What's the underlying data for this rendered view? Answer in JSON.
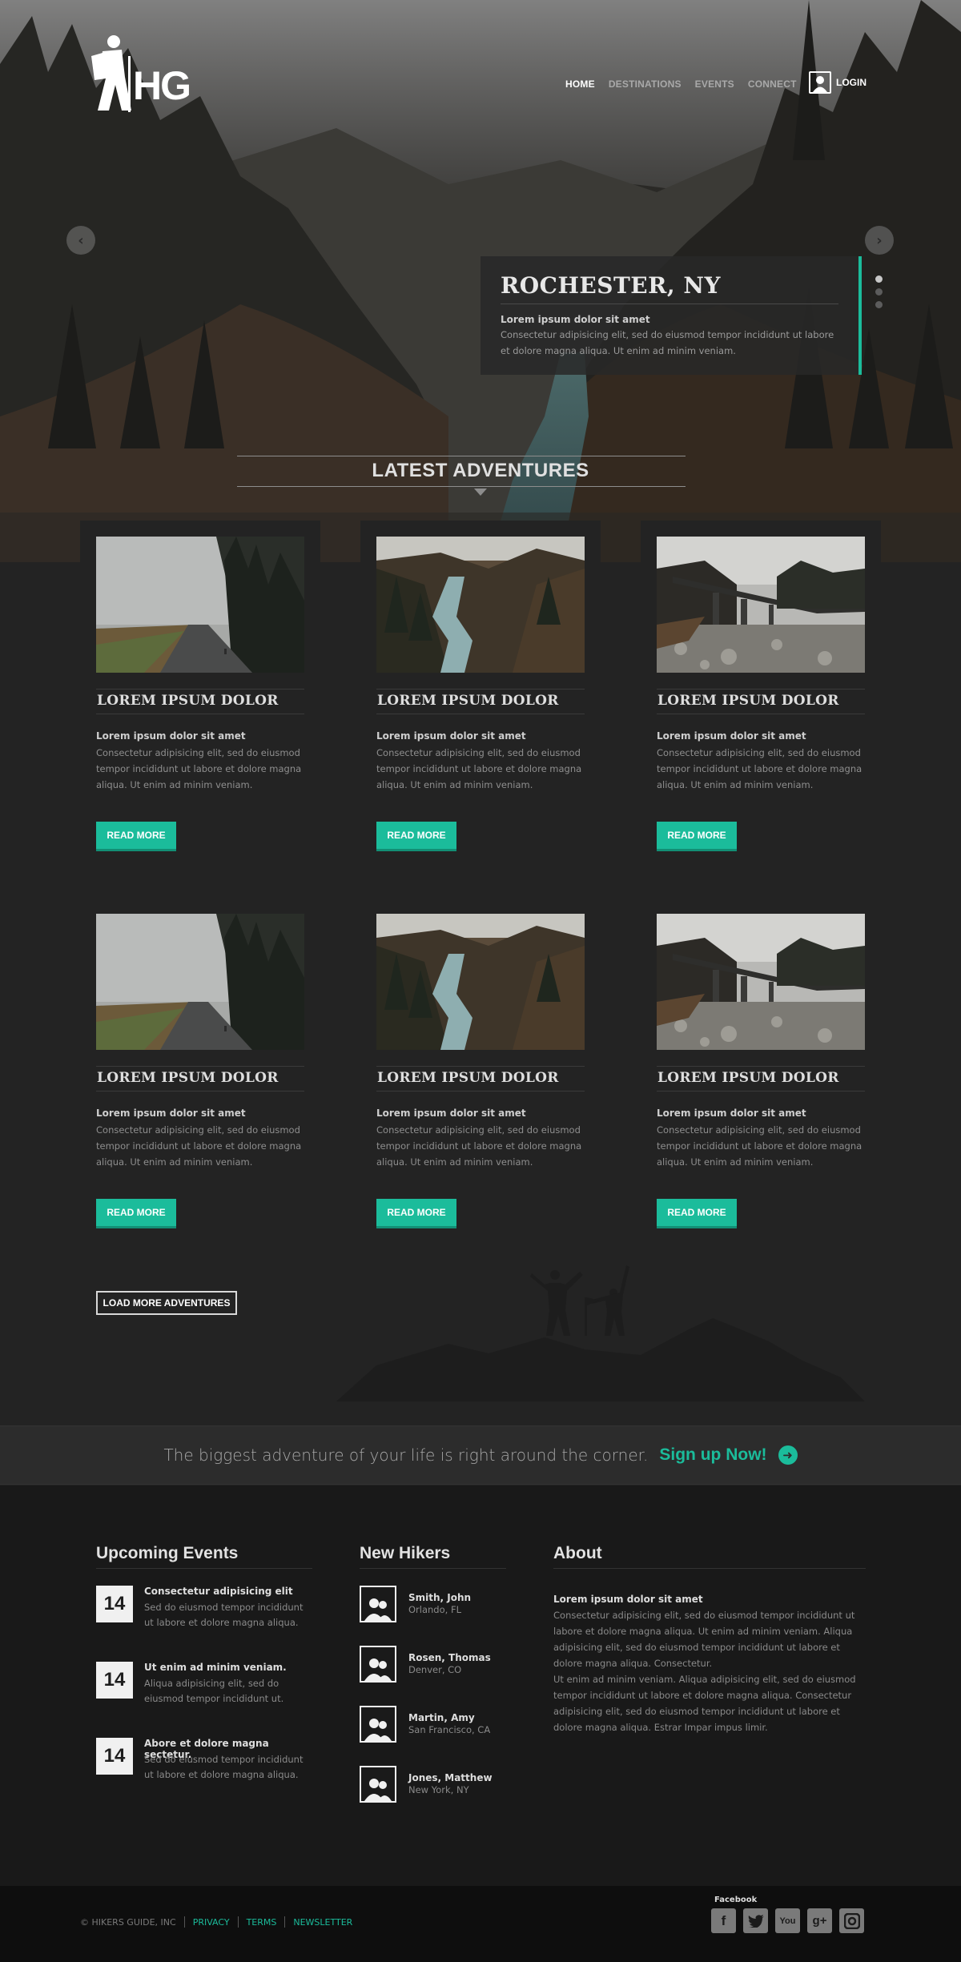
{
  "brand": {
    "logo_text": "HG"
  },
  "nav": {
    "items": [
      "HOME",
      "DESTINATIONS",
      "EVENTS",
      "CONNECT"
    ],
    "active": "HOME",
    "login": "LOGIN"
  },
  "hero": {
    "title": "ROCHESTER, NY",
    "subtitle": "Lorem ipsum dolor sit amet",
    "text": "Consectetur adipisicing elit, sed do eiusmod tempor incididunt ut labore et dolore magna aliqua. Ut enim ad minim veniam.",
    "slide_count": 3,
    "active_slide": 1
  },
  "section_title": "LATEST ADVENTURES",
  "cards": [
    {
      "title": "LOREM IPSUM DOLOR",
      "subtitle": "Lorem ipsum dolor sit amet",
      "text": "Consectetur adipisicing elit, sed do eiusmod tempor incididunt ut labore et dolore magna aliqua. Ut enim ad minim veniam.",
      "button": "READ MORE"
    },
    {
      "title": "LOREM IPSUM DOLOR",
      "subtitle": "Lorem ipsum dolor sit amet",
      "text": "Consectetur adipisicing elit, sed do eiusmod tempor incididunt ut labore et dolore magna aliqua. Ut enim ad minim veniam.",
      "button": "READ MORE"
    },
    {
      "title": "LOREM IPSUM DOLOR",
      "subtitle": "Lorem ipsum dolor sit amet",
      "text": "Consectetur adipisicing elit, sed do eiusmod tempor incididunt ut labore et dolore magna aliqua. Ut enim ad minim veniam.",
      "button": "READ MORE"
    },
    {
      "title": "LOREM IPSUM DOLOR",
      "subtitle": "Lorem ipsum dolor sit amet",
      "text": "Consectetur adipisicing elit, sed do eiusmod tempor incididunt ut labore et dolore magna aliqua. Ut enim ad minim veniam.",
      "button": "READ MORE"
    },
    {
      "title": "LOREM IPSUM DOLOR",
      "subtitle": "Lorem ipsum dolor sit amet",
      "text": "Consectetur adipisicing elit, sed do eiusmod tempor incididunt ut labore et dolore magna aliqua. Ut enim ad minim veniam.",
      "button": "READ MORE"
    },
    {
      "title": "LOREM IPSUM DOLOR",
      "subtitle": "Lorem ipsum dolor sit amet",
      "text": "Consectetur adipisicing elit, sed do eiusmod tempor incididunt ut labore et dolore magna aliqua. Ut enim ad minim veniam.",
      "button": "READ MORE"
    }
  ],
  "load_more": "LOAD MORE ADVENTURES",
  "signup": {
    "text": "The biggest adventure of your life is right around the corner.",
    "cta": "Sign up Now!"
  },
  "events": {
    "heading": "Upcoming Events",
    "items": [
      {
        "date": "14",
        "title": "Consectetur adipisicing elit",
        "text": "Sed do eiusmod tempor incididunt ut labore et dolore magna aliqua."
      },
      {
        "date": "14",
        "title": "Ut enim ad minim veniam.",
        "text": "Aliqua adipisicing elit, sed do eiusmod tempor incididunt ut."
      },
      {
        "date": "14",
        "title": "Abore et dolore magna sectetur.",
        "text": "Sed do eiusmod tempor incididunt ut labore et dolore magna aliqua."
      }
    ]
  },
  "hikers": {
    "heading": "New Hikers",
    "items": [
      {
        "name": "Smith, John",
        "city": "Orlando, FL"
      },
      {
        "name": "Rosen, Thomas",
        "city": "Denver, CO"
      },
      {
        "name": "Martin, Amy",
        "city": "San Francisco, CA"
      },
      {
        "name": "Jones, Matthew",
        "city": "New York, NY"
      }
    ]
  },
  "about": {
    "heading": "About",
    "subtitle": "Lorem ipsum dolor sit amet",
    "p1": "Consectetur adipisicing elit, sed do eiusmod tempor incididunt ut labore et dolore magna aliqua. Ut enim ad minim veniam. Aliqua adipisicing elit, sed do eiusmod tempor incididunt ut labore et dolore magna aliqua. Consectetur.",
    "p2": "Ut enim ad minim veniam. Aliqua adipisicing elit, sed do eiusmod tempor incididunt ut labore et dolore magna aliqua. Consectetur adipisicing elit, sed do eiusmod tempor incididunt ut labore et dolore magna aliqua. Estrar Impar impus limir."
  },
  "footer": {
    "copyright": "© HIKERS GUIDE, INC",
    "links": [
      "PRIVACY",
      "TERMS",
      "NEWSLETTER"
    ],
    "social_label": "Facebook",
    "social": [
      "facebook-icon",
      "twitter-icon",
      "youtube-icon",
      "googleplus-icon",
      "instagram-icon"
    ]
  },
  "colors": {
    "accent": "#1bbc9b",
    "background": "#232323",
    "footer": "#191919"
  }
}
